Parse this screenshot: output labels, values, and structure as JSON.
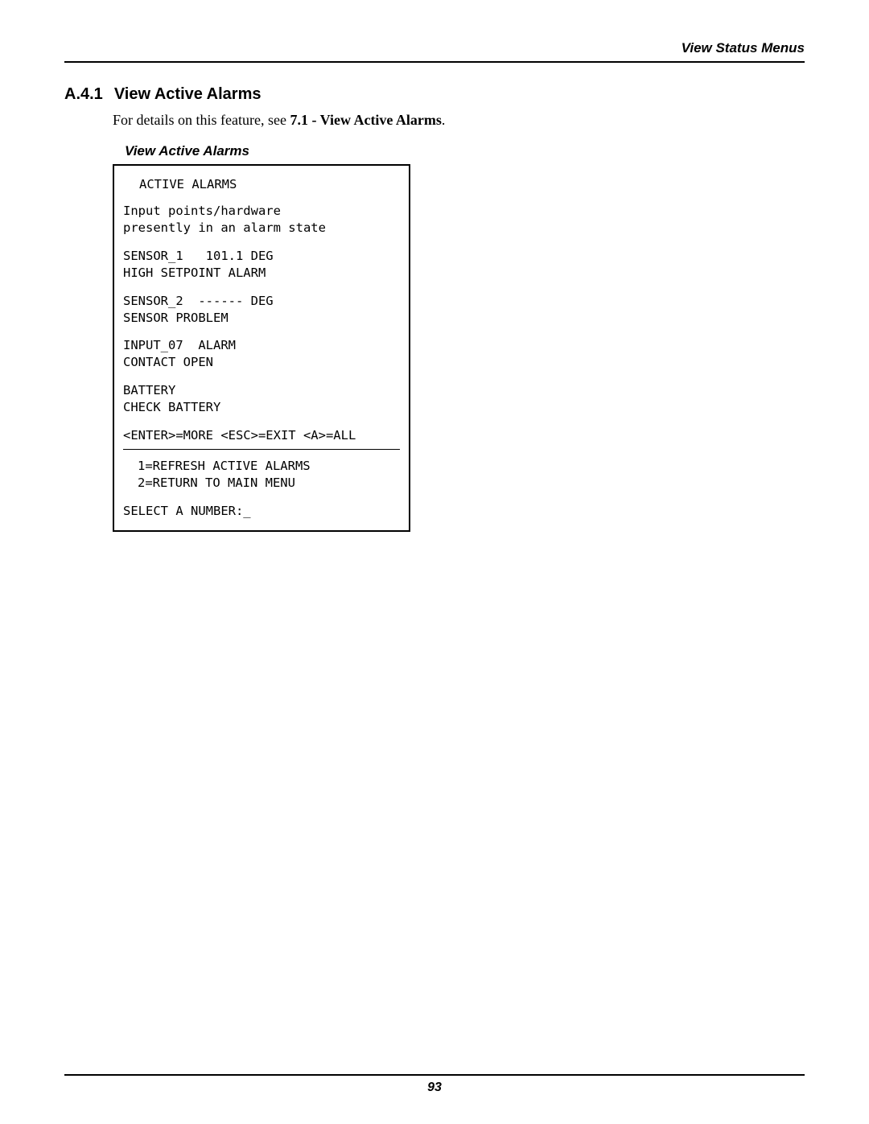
{
  "header": {
    "running_head": "View Status Menus"
  },
  "section": {
    "number": "A.4.1",
    "title": "View Active Alarms",
    "para_prefix": "For details on this feature, see ",
    "xref": "7.1 - View Active Alarms",
    "para_suffix": "."
  },
  "panel": {
    "caption": "View Active Alarms",
    "title": "ACTIVE ALARMS",
    "desc_line1": "Input points/hardware",
    "desc_line2": "presently in an alarm state",
    "alarms": [
      {
        "line1": "SENSOR_1   101.1 DEG",
        "line2": "HIGH SETPOINT ALARM"
      },
      {
        "line1": "SENSOR_2  ------ DEG",
        "line2": "SENSOR PROBLEM"
      },
      {
        "line1": "INPUT_07  ALARM",
        "line2": "CONTACT OPEN"
      },
      {
        "line1": "BATTERY",
        "line2": "CHECK BATTERY"
      }
    ],
    "nav_hint": "<ENTER>=MORE <ESC>=EXIT <A>=ALL",
    "menu_options": [
      "1=REFRESH ACTIVE ALARMS",
      "2=RETURN TO MAIN MENU"
    ],
    "prompt": "SELECT A NUMBER:_"
  },
  "footer": {
    "page_number": "93"
  }
}
